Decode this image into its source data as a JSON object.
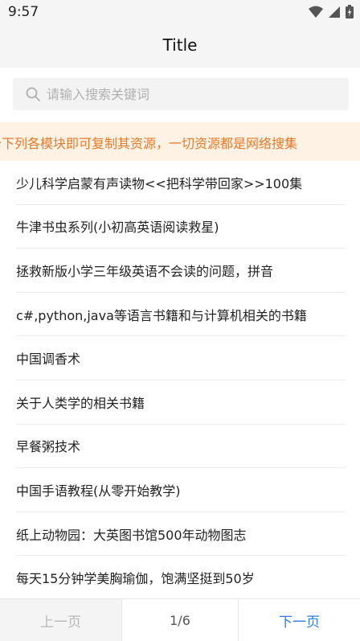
{
  "status_bar": {
    "time": "9:57"
  },
  "navbar": {
    "title": "Title"
  },
  "search": {
    "placeholder": "请输入搜索关键词",
    "value": ""
  },
  "notice": {
    "text": "击下列各模块即可复制其资源，一切资源都是网络搜集"
  },
  "list": {
    "items": [
      "少儿科学启蒙有声读物<<把科学带回家>>100集",
      "牛津书虫系列(小初高英语阅读救星)",
      "拯救新版小学三年级英语不会读的问题，拼音",
      "c#,python,java等语言书籍和与计算机相关的书籍",
      "中国调香术",
      "关于人类学的相关书籍",
      "早餐粥技术",
      "中国手语教程(从零开始教学)",
      "纸上动物园：大英图书馆500年动物图志",
      "每天15分钟学美胸瑜伽，饱满坚挺到50岁"
    ]
  },
  "pager": {
    "prev_label": "上一页",
    "page": "1/6",
    "next_label": "下一页"
  },
  "colors": {
    "accent": "#2b7de0",
    "notice_text": "#e8792b",
    "notice_bg": "#fdf2e3"
  }
}
